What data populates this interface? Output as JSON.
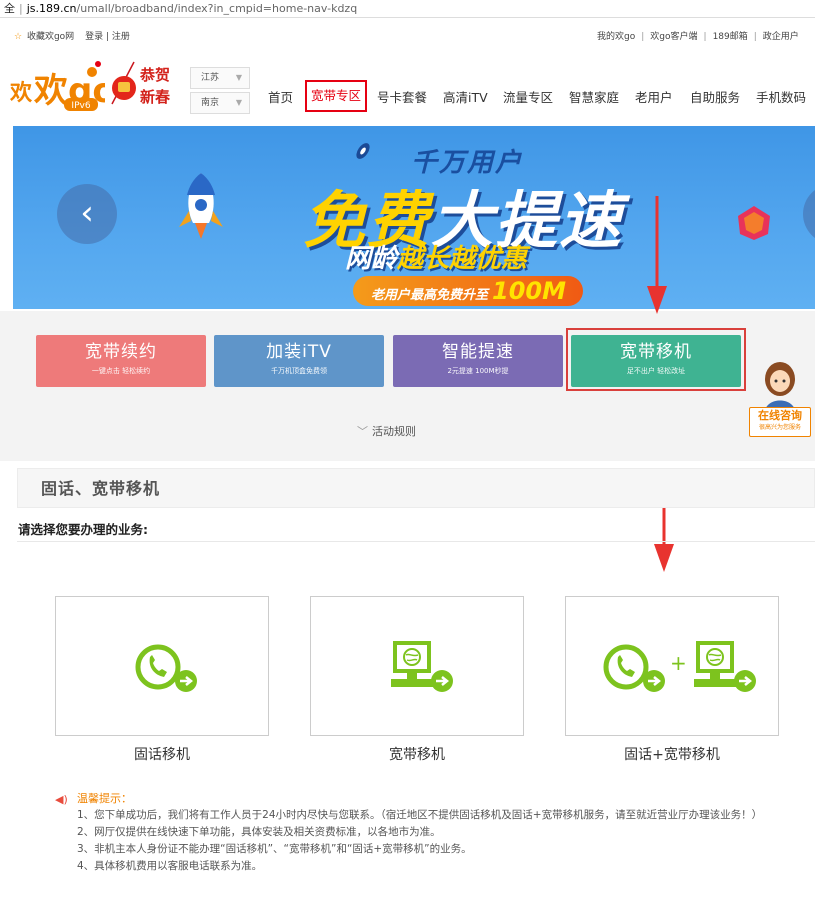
{
  "address_bar": {
    "prefix": "全",
    "host": "js.189.cn",
    "path": "/umall/broadband/index?in_cmpid=home-nav-kdzq"
  },
  "topbar": {
    "favorite": "收藏欢go网",
    "login": "登录 | 注册",
    "right_items": [
      "我的欢go",
      "欢go客户端",
      "189邮箱",
      "政企用户"
    ]
  },
  "header": {
    "logo_text": "欢go",
    "logo_badge": "IPv6",
    "festive_text": [
      "恭贺",
      "新春"
    ],
    "province": "江苏",
    "city": "南京",
    "nav": [
      "首页",
      "宽带专区",
      "号卡套餐",
      "高清iTV",
      "流量专区",
      "智慧家庭",
      "老用户",
      "自助服务",
      "手机数码"
    ],
    "active_nav": "宽带专区"
  },
  "banner": {
    "line1": "千万用户",
    "line2_a": "免费",
    "line2_b": "大提速",
    "line3_a": "网龄",
    "line3_b": "越长越优惠",
    "line4_text": "老用户最高免费升至",
    "line4_big": "100M",
    "prev": "‹"
  },
  "services": [
    {
      "name": "宽带续约",
      "sub": "一键点击 轻松续约",
      "color": "#ee7a7a"
    },
    {
      "name": "加装iTV",
      "sub": "千万机顶盒免费领",
      "color": "#5f95c9"
    },
    {
      "name": "智能提速",
      "sub": "2元提速 100M秒提",
      "color": "#7b6bb4"
    },
    {
      "name": "宽带移机",
      "sub": "足不出户 轻松改址",
      "color": "#3fb392"
    }
  ],
  "rules_label": "活动规则",
  "consult": {
    "title": "在线咨询",
    "sub": "很高兴为您服务"
  },
  "section_title": "固话、宽带移机",
  "prompt": "请选择您要办理的业务:",
  "options": [
    "固话移机",
    "宽带移机",
    "固话+宽带移机"
  ],
  "plus_sign": "+",
  "tips": {
    "title": "温馨提示：",
    "lines": [
      "1、您下单成功后，我们将有工作人员于24小时内尽快与您联系。（宿迁地区不提供固话移机及固话+宽带移机服务，请至就近营业厅办理该业务！）",
      "2、网厅仅提供在线快速下单功能，具体安装及相关资费标准，以各地市为准。",
      "3、非机主本人身份证不能办理“固话移机”、“宽带移机”和“固话+宽带移机”的业务。",
      "4、具体移机费用以客服电话联系为准。"
    ]
  },
  "colors": {
    "brand_orange": "#f08300",
    "icon_green": "#7dc31e",
    "highlight_red": "#e60012"
  }
}
